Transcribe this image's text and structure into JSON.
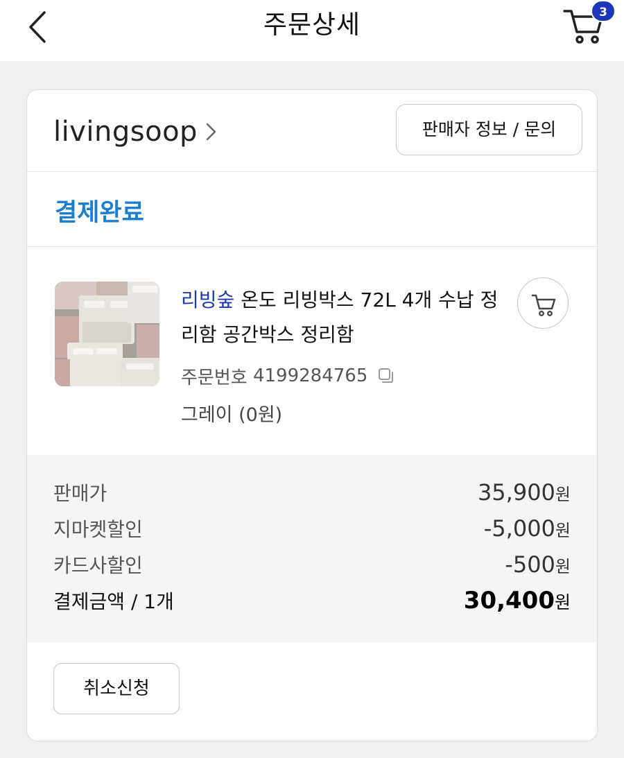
{
  "header": {
    "title": "주문상세",
    "back_icon": "chevron-left-icon",
    "cart_icon": "cart-icon",
    "cart_count": "3"
  },
  "seller": {
    "name": "livingsoop",
    "chevron_icon": "chevron-right-icon",
    "info_button": "판매자 정보 / 문의"
  },
  "status": {
    "label": "결제완료",
    "color": "#1b7ed0"
  },
  "product": {
    "brand": "리빙숲",
    "name": "온도 리빙박스 72L 4개 수납 정리함 공간박스 정리함",
    "order_number_label": "주문번호",
    "order_number": "4199284765",
    "copy_icon": "copy-icon",
    "option": "그레이 (0원)",
    "add_to_cart_icon": "cart-icon"
  },
  "prices": [
    {
      "label": "판매가",
      "amount": "35,900",
      "unit": "원"
    },
    {
      "label": "지마켓할인",
      "amount": "-5,000",
      "unit": "원"
    },
    {
      "label": "카드사할인",
      "amount": "-500",
      "unit": "원"
    },
    {
      "label": "결제금액 / 1개",
      "amount": "30,400",
      "unit": "원"
    }
  ],
  "actions": {
    "cancel": "취소신청"
  },
  "colors": {
    "brand_link": "#1d3aa8",
    "badge": "#1d35b8"
  }
}
